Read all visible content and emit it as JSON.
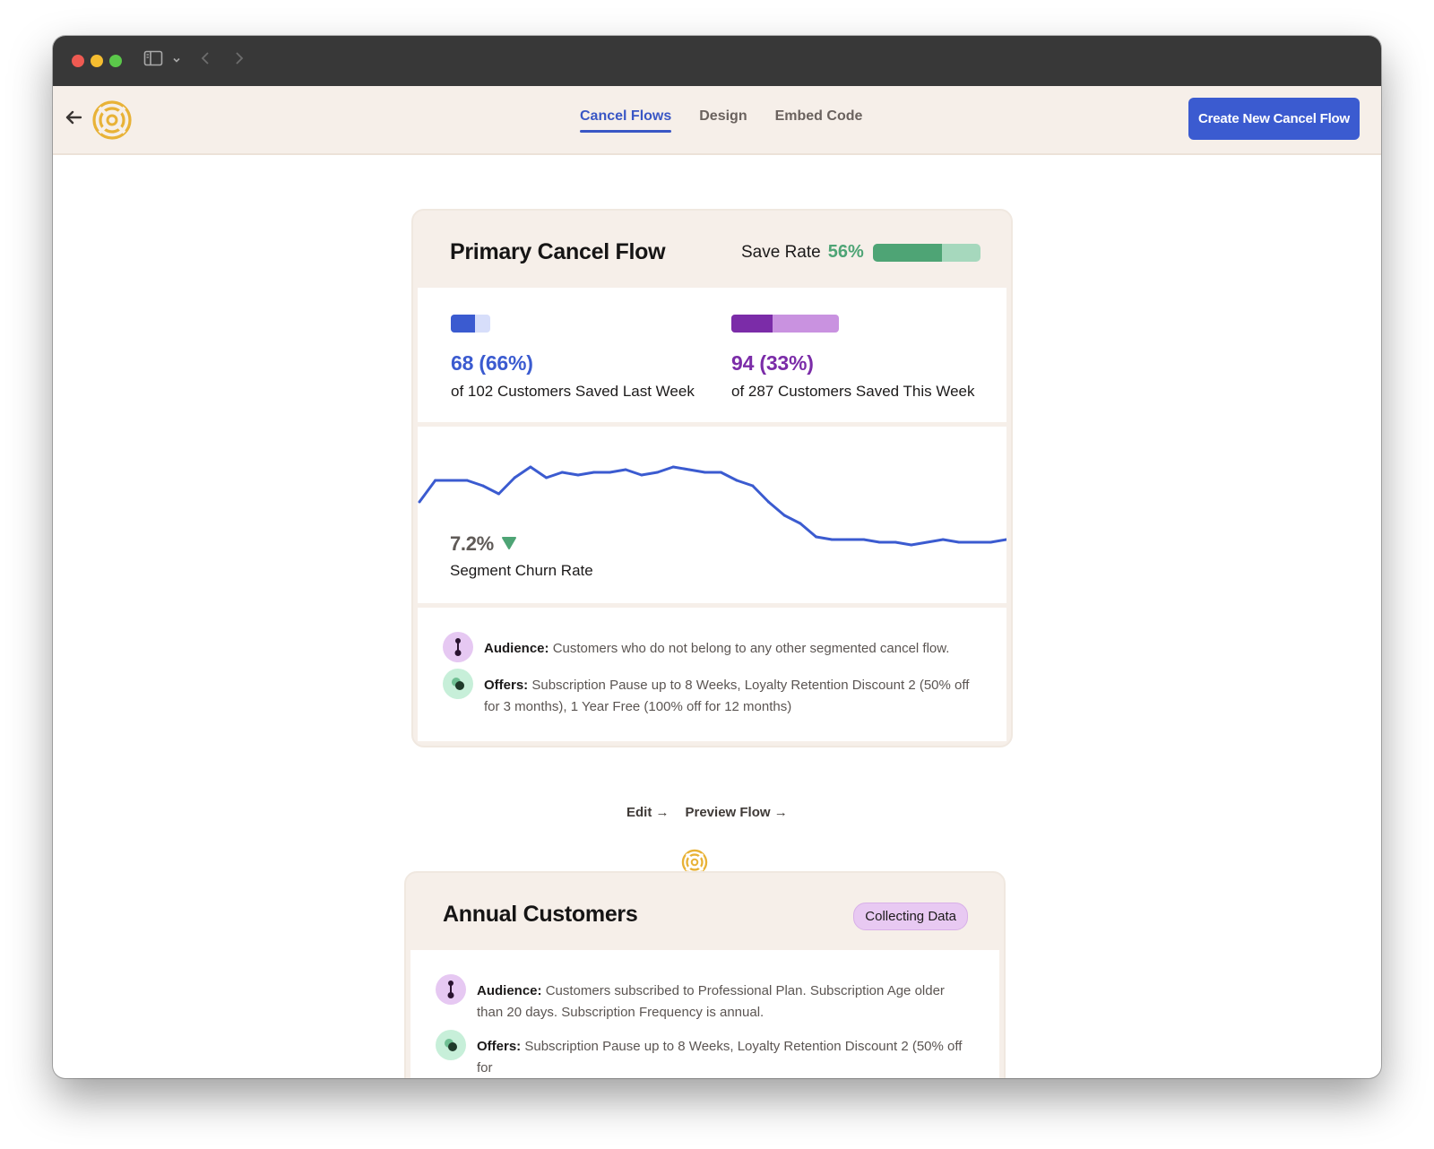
{
  "nav": {
    "tabs": [
      {
        "label": "Cancel Flows",
        "active": true
      },
      {
        "label": "Design",
        "active": false
      },
      {
        "label": "Embed Code",
        "active": false
      }
    ],
    "create_button": "Create New Cancel Flow"
  },
  "primary": {
    "title": "Primary Cancel Flow",
    "save_rate_label": "Save Rate",
    "save_rate_value": "56%",
    "save_rate_fraction": 0.64,
    "last_week": {
      "value": "68 (66%)",
      "desc": "of 102 Customers Saved Last Week",
      "fraction": 0.62,
      "color": "#3b5bd0",
      "track": "#d7defa"
    },
    "this_week": {
      "value": "94 (33%)",
      "desc": "of 287 Customers Saved This Week",
      "fraction": 0.38,
      "color": "#7b2ca8",
      "track": "#c992e0"
    },
    "churn_value": "7.2%",
    "churn_label": "Segment Churn Rate",
    "audience_label": "Audience:",
    "audience_text": "Customers who do not belong to any other segmented cancel flow.",
    "offers_label": "Offers:",
    "offers_text": "Subscription Pause up to 8 Weeks, Loyalty Retention Discount 2 (50% off for 3 months),  1 Year Free (100% off for 12 months)"
  },
  "links": {
    "edit": "Edit →",
    "preview": "Preview Flow →"
  },
  "annual": {
    "title": "Annual Customers",
    "badge": "Collecting Data",
    "audience_label": "Audience:",
    "audience_text": "Customers subscribed to Professional Plan. Subscription Age older than 20 days. Subscription Frequency is annual.",
    "offers_label": "Offers:",
    "offers_text": "Subscription Pause up to 8 Weeks, Loyalty Retention Discount 2 (50% off for"
  },
  "chart_data": {
    "type": "line",
    "series": [
      {
        "values": [
          22,
          30,
          30,
          30,
          28,
          25,
          31,
          35,
          31,
          33,
          32,
          33,
          33,
          34,
          32,
          33,
          35,
          34,
          33,
          33,
          30,
          28,
          22,
          17,
          14,
          9,
          8,
          8,
          8,
          7,
          7,
          6,
          7,
          8,
          7,
          7,
          7,
          8
        ]
      }
    ],
    "ylim": [
      0,
      40
    ],
    "color": "#3b5bd0"
  },
  "colors": {
    "accent": "#3b5bd0",
    "brand_gold": "#e8b237",
    "save_green": "#4ea475"
  }
}
